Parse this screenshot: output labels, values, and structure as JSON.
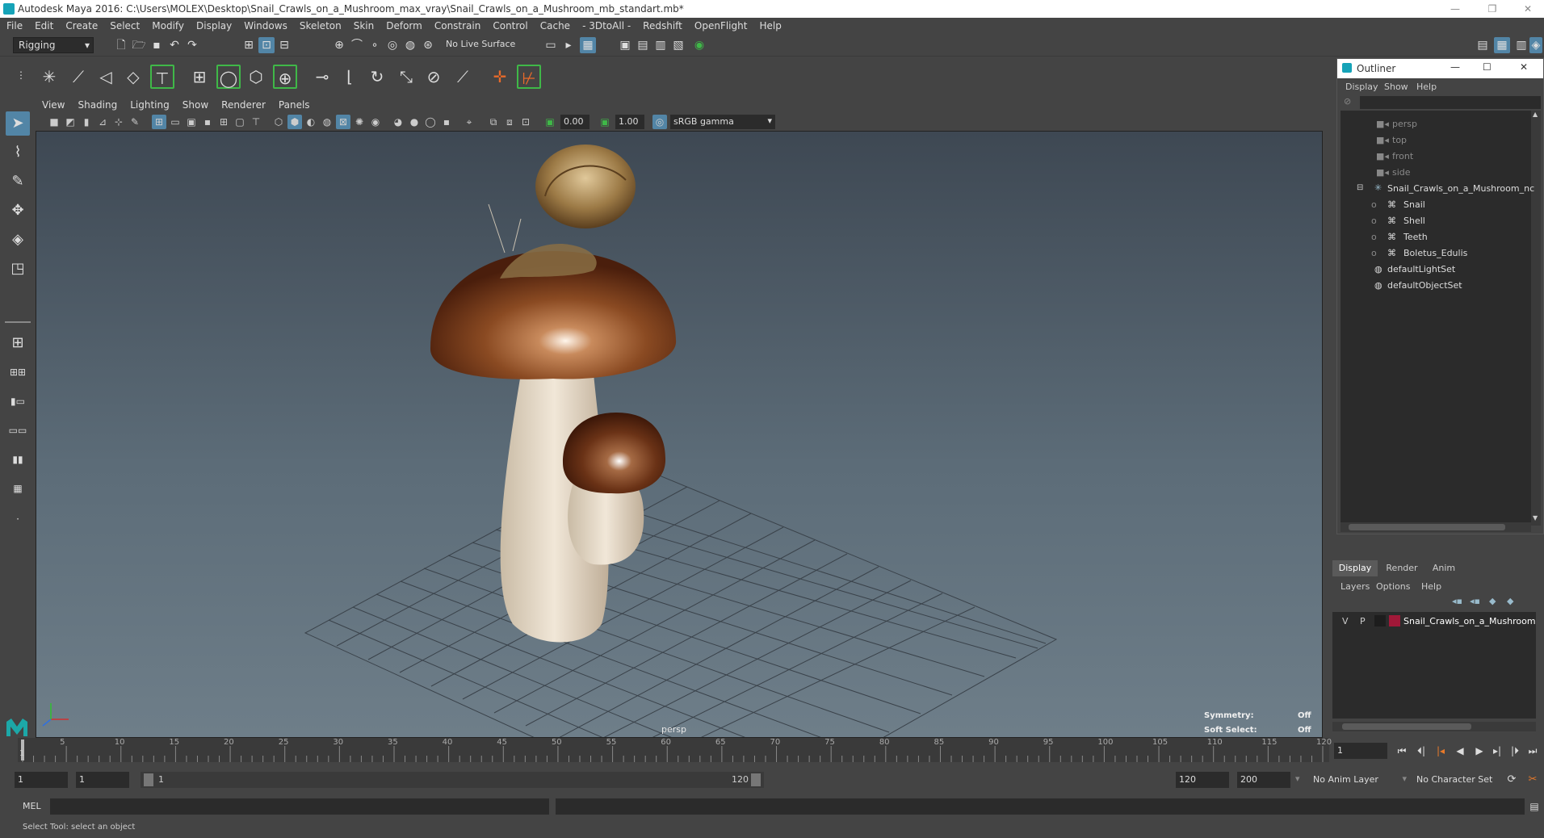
{
  "title_bar": {
    "title": "Autodesk Maya 2016: C:\\Users\\MOLEX\\Desktop\\Snail_Crawls_on_a_Mushroom_max_vray\\Snail_Crawls_on_a_Mushroom_mb_standart.mb*"
  },
  "menu": [
    "File",
    "Edit",
    "Create",
    "Select",
    "Modify",
    "Display",
    "Windows",
    "Skeleton",
    "Skin",
    "Deform",
    "Constrain",
    "Control",
    "Cache",
    "- 3DtoAll -",
    "Redshift",
    "OpenFlight",
    "Help"
  ],
  "status_line": {
    "menu_set": "Rigging",
    "live_surface": "No Live Surface"
  },
  "viewport_menu": [
    "View",
    "Shading",
    "Lighting",
    "Show",
    "Renderer",
    "Panels"
  ],
  "viewport_toolbar": {
    "exposure": "0.00",
    "gamma": "1.00",
    "color_space": "sRGB gamma"
  },
  "viewport": {
    "camera_label": "persp",
    "symmetry_label": "Symmetry:",
    "symmetry_value": "Off",
    "soft_select_label": "Soft Select:",
    "soft_select_value": "Off"
  },
  "outliner": {
    "title": "Outliner",
    "menu": [
      "Display",
      "Show",
      "Help"
    ],
    "items": [
      {
        "label": "persp",
        "kind": "camera",
        "depth": 1,
        "dim": true
      },
      {
        "label": "top",
        "kind": "camera",
        "depth": 1,
        "dim": true
      },
      {
        "label": "front",
        "kind": "camera",
        "depth": 1,
        "dim": true
      },
      {
        "label": "side",
        "kind": "camera",
        "depth": 1,
        "dim": true
      },
      {
        "label": "Snail_Crawls_on_a_Mushroom_nc",
        "kind": "group",
        "depth": 1,
        "dim": false
      },
      {
        "label": "Snail",
        "kind": "mesh",
        "depth": 2,
        "dim": false
      },
      {
        "label": "Shell",
        "kind": "mesh",
        "depth": 2,
        "dim": false
      },
      {
        "label": "Teeth",
        "kind": "mesh",
        "depth": 2,
        "dim": false
      },
      {
        "label": "Boletus_Edulis",
        "kind": "mesh",
        "depth": 2,
        "dim": false
      },
      {
        "label": "defaultLightSet",
        "kind": "set",
        "depth": 1,
        "dim": false
      },
      {
        "label": "defaultObjectSet",
        "kind": "set",
        "depth": 1,
        "dim": false
      }
    ]
  },
  "layer_editor": {
    "tabs": [
      "Display",
      "Render",
      "Anim"
    ],
    "menu": [
      "Layers",
      "Options",
      "Help"
    ],
    "layer": {
      "v": "V",
      "p": "P",
      "name": "Snail_Crawls_on_a_Mushroom",
      "color": "#a01838"
    }
  },
  "time_slider": {
    "ticks": [
      "5",
      "10",
      "15",
      "20",
      "25",
      "30",
      "35",
      "40",
      "45",
      "50",
      "55",
      "60",
      "65",
      "70",
      "75",
      "80",
      "85",
      "90",
      "95",
      "100",
      "105",
      "110",
      "115",
      "120"
    ],
    "start_marker": "1",
    "current_frame": "1"
  },
  "range_slider": {
    "start": "1",
    "playback_start": "1",
    "range_start_label": "1",
    "range_end_label": "120",
    "playback_end": "120",
    "end": "200",
    "anim_layer": "No Anim Layer",
    "character_set": "No Character Set"
  },
  "command_line": {
    "label": "MEL"
  },
  "help_line": {
    "text": "Select Tool: select an object"
  }
}
